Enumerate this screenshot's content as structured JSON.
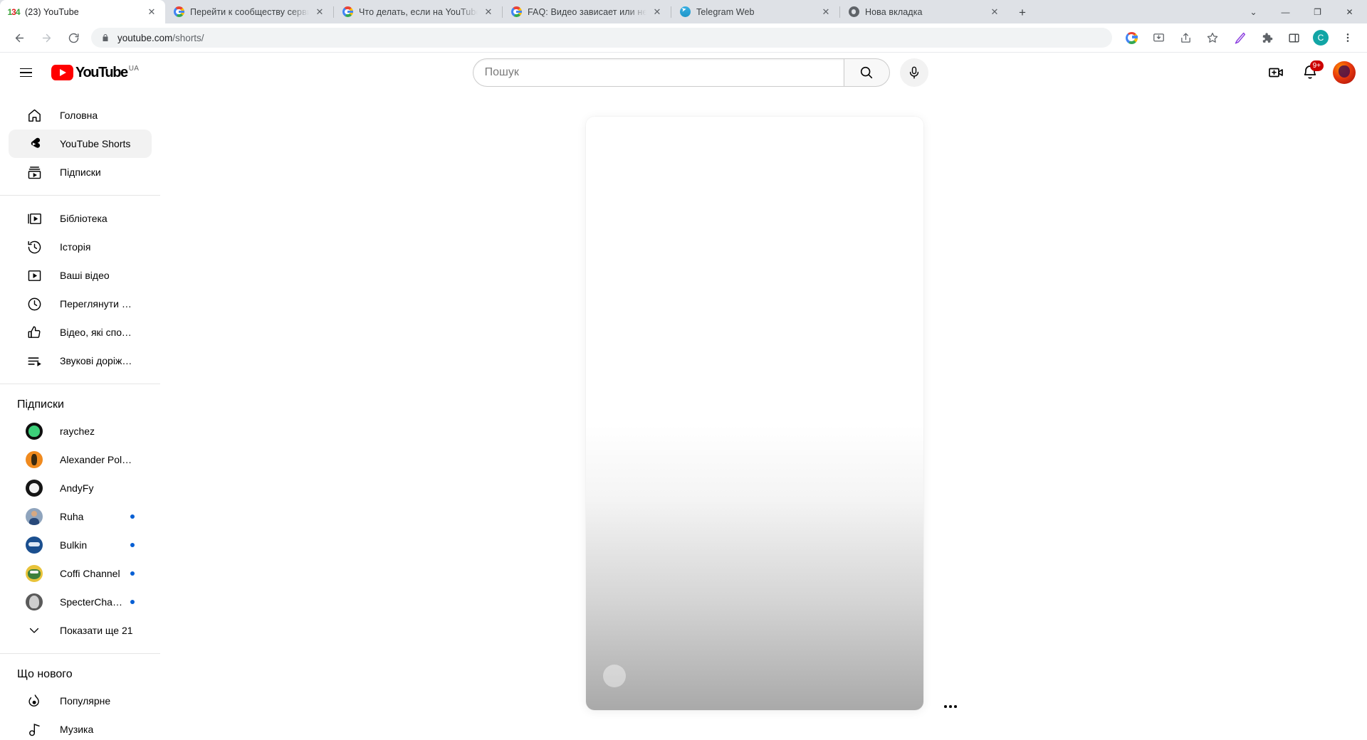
{
  "browser": {
    "tabs": [
      {
        "title": "(23) YouTube",
        "favicon": "youtube-counter-icon",
        "active": true
      },
      {
        "title": "Перейти к сообществу сервиса",
        "favicon": "google-icon",
        "active": false
      },
      {
        "title": "Что делать, если на YouTube по",
        "favicon": "google-icon",
        "active": false
      },
      {
        "title": "FAQ: Видео зависает или не з",
        "favicon": "google-icon",
        "active": false
      },
      {
        "title": "Telegram Web",
        "favicon": "telegram-icon",
        "active": false
      },
      {
        "title": "Нова вкладка",
        "favicon": "chrome-icon",
        "active": false
      }
    ],
    "new_tab_label": "+",
    "window_controls": {
      "minimize": "—",
      "maximize": "❐",
      "close": "✕",
      "tab_search": "⌄"
    },
    "nav": {
      "back": "←",
      "forward": "→",
      "reload": "⟳"
    },
    "omnibox": {
      "lock": "site-information-icon",
      "host": "youtube.com",
      "path": "/shorts/",
      "full_url": "youtube.com/shorts/"
    },
    "toolbar_icons": [
      "google-lens-icon",
      "install-app-icon",
      "share-icon",
      "bookmark-star-icon",
      "pen-annotate-icon",
      "extensions-puzzle-icon",
      "side-panel-icon"
    ],
    "profile_initial": "C",
    "profile_color": "#12a5a5",
    "menu": "chrome-menu-icon"
  },
  "youtube": {
    "header": {
      "menu_label": "guide-menu",
      "logo_text": "YouTube",
      "country_code": "UA",
      "search_placeholder": "Пошук",
      "search_value": "",
      "search_button": "search-icon",
      "mic_button": "voice-search-icon",
      "create_button": "create-video-icon",
      "notifications_button": "notifications-icon",
      "notifications_count": "9+",
      "avatar": "account-avatar"
    },
    "sidebar": {
      "primary": [
        {
          "label": "Головна",
          "icon": "home-icon",
          "active": false
        },
        {
          "label": "YouTube Shorts",
          "icon": "shorts-icon",
          "active": true
        },
        {
          "label": "Підписки",
          "icon": "subscriptions-icon",
          "active": false
        }
      ],
      "secondary": [
        {
          "label": "Бібліотека",
          "icon": "library-icon"
        },
        {
          "label": "Історія",
          "icon": "history-icon"
        },
        {
          "label": "Ваші відео",
          "icon": "your-videos-icon"
        },
        {
          "label": "Переглянути пізні…",
          "icon": "watch-later-icon"
        },
        {
          "label": "Відео, які сподоба…",
          "icon": "liked-videos-icon"
        },
        {
          "label": "Звукові доріжки з …",
          "icon": "playlist-icon"
        }
      ],
      "subscriptions_title": "Підписки",
      "subscriptions": [
        {
          "name": "raychez",
          "color": "#0f0f0f",
          "accent": "#3dd07a",
          "new": false
        },
        {
          "name": "Alexander PolyAK",
          "color": "#f08a1e",
          "accent": "#3a2a10",
          "new": false
        },
        {
          "name": "AndyFy",
          "color": "#151515",
          "accent": "#f2f2f2",
          "new": false
        },
        {
          "name": "Ruha",
          "color": "#8fa4bd",
          "accent": "#28497a",
          "new": true
        },
        {
          "name": "Bulkin",
          "color": "#1b4f8f",
          "accent": "#dfe9f5",
          "new": true
        },
        {
          "name": "Coffi Channel",
          "color": "#e8c33a",
          "accent": "#3c7f3c",
          "new": true
        },
        {
          "name": "SpecterChannel",
          "color": "#5a5a5a",
          "accent": "#cfcfcf",
          "new": true
        }
      ],
      "show_more": "Показати ще 21",
      "explore_title": "Що нового",
      "explore": [
        {
          "label": "Популярне",
          "icon": "trending-icon"
        },
        {
          "label": "Музика",
          "icon": "music-icon"
        }
      ]
    },
    "shorts": {
      "state": "loading",
      "player_placeholder": "shorts-video-placeholder",
      "avatar_placeholder": "channel-avatar-placeholder",
      "more_actions": "more-actions-icon"
    }
  }
}
